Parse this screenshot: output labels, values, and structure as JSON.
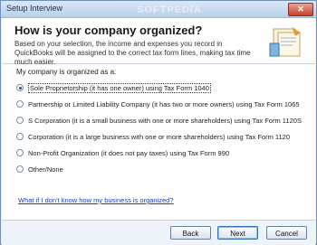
{
  "window": {
    "title": "Setup Interview",
    "close_label": "✕",
    "watermark": "SOFTPEDIA"
  },
  "header": {
    "title": "How is your company organized?",
    "description": "Based on your selection, the income and expenses you record in QuickBooks will be assigned to the correct tax form lines, making tax time much easier.",
    "icon": "tax-documents-icon"
  },
  "form": {
    "lead": "My company is organized as a:",
    "options": [
      {
        "label": "Sole Proprietorship (it has one owner) using Tax Form 1040",
        "selected": true
      },
      {
        "label": "Partnership or Limited Liability Company (it has two or more owners) using Tax Form 1065",
        "selected": false
      },
      {
        "label": "S Corporation (it is a small business with one or more shareholders) using Tax Form 1120S",
        "selected": false
      },
      {
        "label": "Corporation (it is a large business with one or more shareholders) using Tax Form 1120",
        "selected": false
      },
      {
        "label": "Non-Profit Organization (it does not pay taxes) using Tax Form 990",
        "selected": false
      },
      {
        "label": "Other/None",
        "selected": false
      }
    ],
    "help_link": "What if I don't know how my business is organized?"
  },
  "footer": {
    "back_label": "Back",
    "next_label": "Next",
    "cancel_label": "Cancel"
  }
}
